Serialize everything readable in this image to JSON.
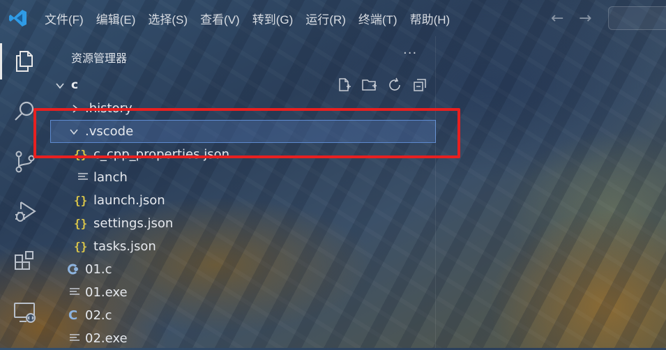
{
  "titlebar": {
    "menu": [
      "文件(F)",
      "编辑(E)",
      "选择(S)",
      "查看(V)",
      "转到(G)",
      "运行(R)",
      "终端(T)",
      "帮助(H)"
    ],
    "back_glyph": "←",
    "forward_glyph": "→"
  },
  "activitybar": {
    "items": [
      "explorer-icon",
      "search-icon",
      "source-control-icon",
      "run-debug-icon",
      "extensions-icon",
      "remote-explorer-icon"
    ],
    "active": "explorer-icon"
  },
  "explorer": {
    "title": "资源管理器",
    "more_glyph": "···",
    "folder": "c",
    "toolbar": [
      "new-file-icon",
      "new-folder-icon",
      "refresh-icon",
      "collapse-all-icon"
    ],
    "rows": [
      {
        "label": ".history",
        "type": "folder",
        "expanded": false
      },
      {
        "label": ".vscode",
        "type": "folder",
        "expanded": true,
        "selected": true
      },
      {
        "label": "c_cpp_properties.json",
        "type": "json"
      },
      {
        "label": "lanch",
        "type": "text"
      },
      {
        "label": "launch.json",
        "type": "json"
      },
      {
        "label": "settings.json",
        "type": "json"
      },
      {
        "label": "tasks.json",
        "type": "json"
      },
      {
        "label": "01.c",
        "type": "c-modified"
      },
      {
        "label": "01.exe",
        "type": "text"
      },
      {
        "label": "02.c",
        "type": "c"
      },
      {
        "label": "02.exe",
        "type": "text"
      }
    ]
  },
  "json_glyph": "{}",
  "c_glyph": "C",
  "colors": {
    "selection_border": "#5d8ad0",
    "annotation_red": "#e82020",
    "json_icon": "#d8c44a",
    "c_icon": "#8db3de",
    "vscode_blue": "#2f9be6"
  }
}
